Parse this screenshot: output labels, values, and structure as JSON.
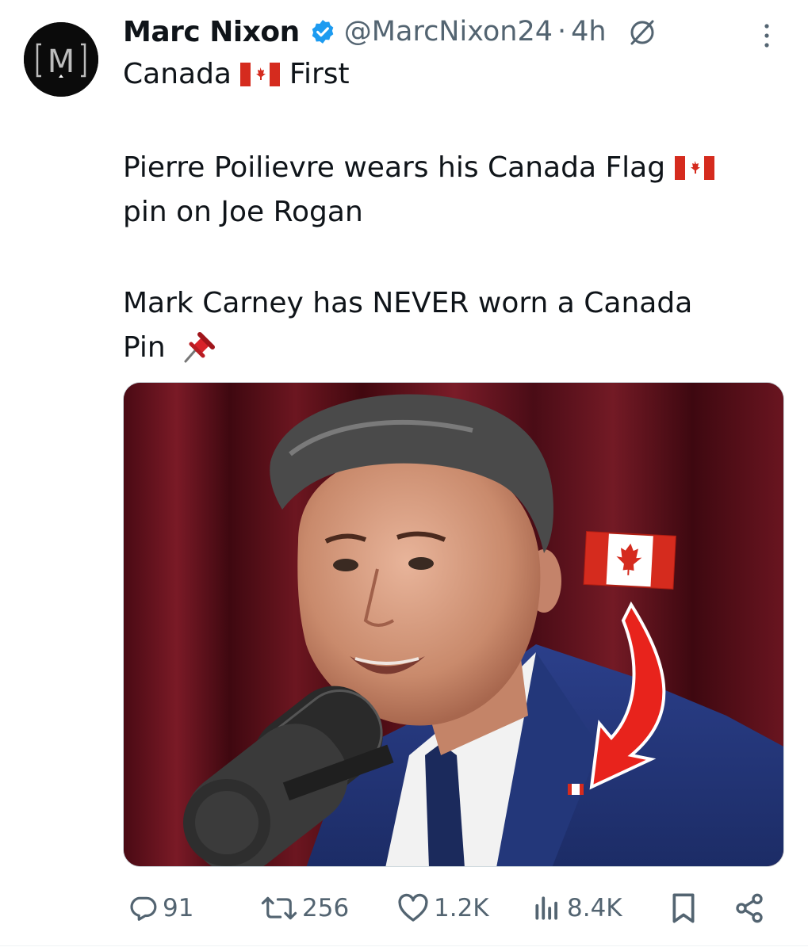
{
  "post": {
    "author_name": "Marc Nixon",
    "author_handle": "@MarcNixon24",
    "separator": "·",
    "time_ago": "4h",
    "avatar_letter": "M",
    "line1_prefix": "Canada",
    "line1_suffix": "First",
    "line2_text": "Pierre Poilievre wears his Canada Flag",
    "line3_text": "pin on Joe Rogan",
    "line4_text": "Mark Carney has NEVER worn a Canada",
    "line5_text": "Pin"
  },
  "actions": {
    "replies": "91",
    "reposts": "256",
    "likes": "1.2K",
    "views": "8.4K"
  },
  "icons": {
    "verified": "verified-badge-icon",
    "grok": "grok-icon",
    "more": "more-options-icon",
    "flag": "canada-flag-emoji",
    "pushpin": "pushpin-emoji",
    "reply": "reply-icon",
    "repost": "repost-icon",
    "like": "heart-icon",
    "views": "views-icon",
    "bookmark": "bookmark-icon",
    "share": "share-icon"
  },
  "colors": {
    "text": "#0f1419",
    "secondary": "#536471",
    "verified": "#1d9bf0",
    "flag_red": "#d52b1e"
  }
}
